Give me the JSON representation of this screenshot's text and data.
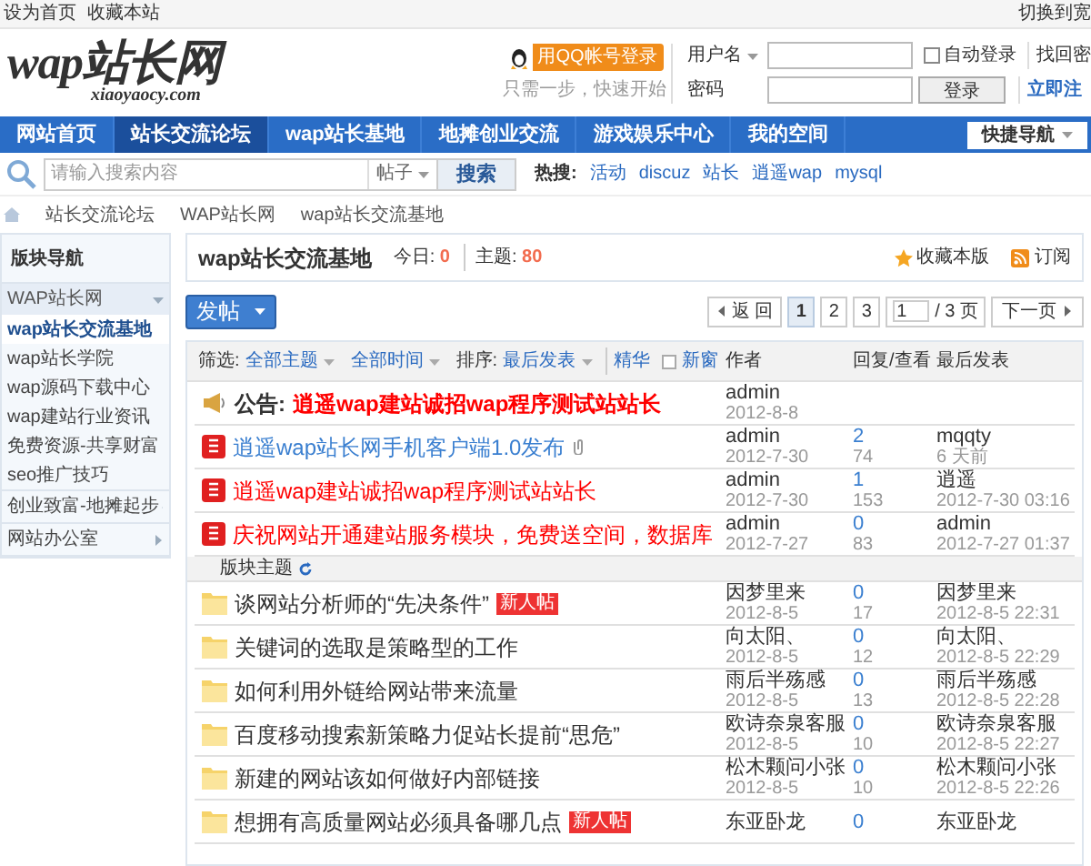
{
  "top_bar": {
    "links": [
      "设为首页",
      "收藏本站"
    ],
    "right_link": "切换到宽"
  },
  "logo": {
    "title": "wap站长网",
    "subtitle": "xiaoyaocy.com"
  },
  "qq_login": {
    "label": "用QQ帐号登录",
    "hint": "只需一步，快速开始"
  },
  "login": {
    "username_label": "用户名",
    "password_label": "密码",
    "auto_login": {
      "label": "自动登录",
      "checked": false
    },
    "login_button": "登录",
    "forgot_link": "找回密",
    "register_link": "立即注"
  },
  "nav": {
    "items": [
      {
        "label": "网站首页",
        "selected": false
      },
      {
        "label": "站长交流论坛",
        "selected": true
      },
      {
        "label": "wap站长基地",
        "selected": false
      },
      {
        "label": "地摊创业交流",
        "selected": false
      },
      {
        "label": "游戏娱乐中心",
        "selected": false
      },
      {
        "label": "我的空间",
        "selected": false
      }
    ],
    "quick_nav": "快捷导航"
  },
  "search": {
    "placeholder": "请输入搜索内容",
    "scope": "帖子",
    "button": "搜索",
    "hot_label": "热搜:",
    "hot_links": [
      "活动",
      "discuz",
      "站长",
      "逍遥wap",
      "mysql"
    ]
  },
  "breadcrumb": [
    "站长交流论坛",
    "WAP站长网",
    "wap站长交流基地"
  ],
  "sidebar": {
    "title": "版块导航",
    "groups": [
      {
        "label": "WAP站长网",
        "expanded": true,
        "children": [
          {
            "label": "wap站长交流基地",
            "selected": true
          },
          {
            "label": "wap站长学院",
            "selected": false
          },
          {
            "label": "wap源码下载中心",
            "selected": false
          },
          {
            "label": "wap建站行业资讯",
            "selected": false
          },
          {
            "label": "免费资源-共享财富",
            "selected": false
          },
          {
            "label": "seo推广技巧",
            "selected": false
          }
        ]
      },
      {
        "label": "创业致富-地摊起步",
        "expanded": false
      },
      {
        "label": "网站办公室",
        "expanded": false
      }
    ]
  },
  "forum": {
    "title": "wap站长交流基地",
    "today_label": "今日:",
    "today": "0",
    "topics_label": "主题:",
    "topics": "80",
    "favorite": "收藏本版",
    "subscribe": "订阅"
  },
  "post_button": "发帖",
  "pagination": {
    "back": "返 回",
    "pages": [
      {
        "label": "1",
        "selected": true
      },
      {
        "label": "2",
        "selected": false
      },
      {
        "label": "3",
        "selected": false
      }
    ],
    "page_input": "1",
    "total": "/ 3 页",
    "next": "下一页"
  },
  "filter": {
    "filter_label": "筛选:",
    "topic_filter": "全部主题",
    "time_filter": "全部时间",
    "sort_label": "排序:",
    "sort": "最后发表",
    "digest": "精华",
    "new_window": {
      "label": "新窗",
      "checked": false
    },
    "columns": [
      "作者",
      "回复/查看",
      "最后发表"
    ]
  },
  "sticky_rows": [
    {
      "kind": "notice",
      "prefix": "公告:",
      "title": "逍遥wap建站诚招wap程序测试站站长",
      "color": "#ff0000",
      "author": "admin",
      "date": "2012-8-8"
    },
    {
      "kind": "sticky",
      "title": "逍遥wap站长网手机客户端1.0发布",
      "color": "#3a7fd0",
      "attachment": true,
      "author": "admin",
      "date": "2012-7-30",
      "replies": "2",
      "views": "74",
      "last_user": "mqqty",
      "last_time": "6 天前"
    },
    {
      "kind": "sticky",
      "title": "逍遥wap建站诚招wap程序测试站站长",
      "color": "#ff0000",
      "author": "admin",
      "date": "2012-7-30",
      "replies": "1",
      "views": "153",
      "last_user": "逍遥",
      "last_time": "2012-7-30 03:16"
    },
    {
      "kind": "sticky",
      "title": "庆祝网站开通建站服务模块，免费送空间，数据库",
      "color": "#ff0000",
      "author": "admin",
      "date": "2012-7-27",
      "replies": "0",
      "views": "83",
      "last_user": "admin",
      "last_time": "2012-7-27 01:37"
    }
  ],
  "section_label": "版块主题",
  "rows": [
    {
      "title": "谈网站分析师的“先决条件”",
      "badge": "新人帖",
      "author": "因梦里来",
      "date": "2012-8-5",
      "replies": "0",
      "views": "17",
      "last_user": "因梦里来",
      "last_time": "2012-8-5 22:31"
    },
    {
      "title": "关键词的选取是策略型的工作",
      "author": "向太阳、",
      "date": "2012-8-5",
      "replies": "0",
      "views": "12",
      "last_user": "向太阳、",
      "last_time": "2012-8-5 22:29"
    },
    {
      "title": "如何利用外链给网站带来流量",
      "author": "雨后半殇感",
      "date": "2012-8-5",
      "replies": "0",
      "views": "13",
      "last_user": "雨后半殇感",
      "last_time": "2012-8-5 22:28"
    },
    {
      "title": "百度移动搜索新策略力促站长提前“思危”",
      "author": "欧诗奈泉客服",
      "date": "2012-8-5",
      "replies": "0",
      "views": "10",
      "last_user": "欧诗奈泉客服",
      "last_time": "2012-8-5 22:27"
    },
    {
      "title": "新建的网站该如何做好内部链接",
      "author": "松木颗问小张",
      "date": "2012-8-5",
      "replies": "0",
      "views": "10",
      "last_user": "松木颗问小张",
      "last_time": "2012-8-5 22:26"
    },
    {
      "title": "想拥有高质量网站必须具备哪几点",
      "badge": "新人帖",
      "author": "东亚卧龙",
      "replies": "0",
      "last_user": "东亚卧龙"
    }
  ]
}
